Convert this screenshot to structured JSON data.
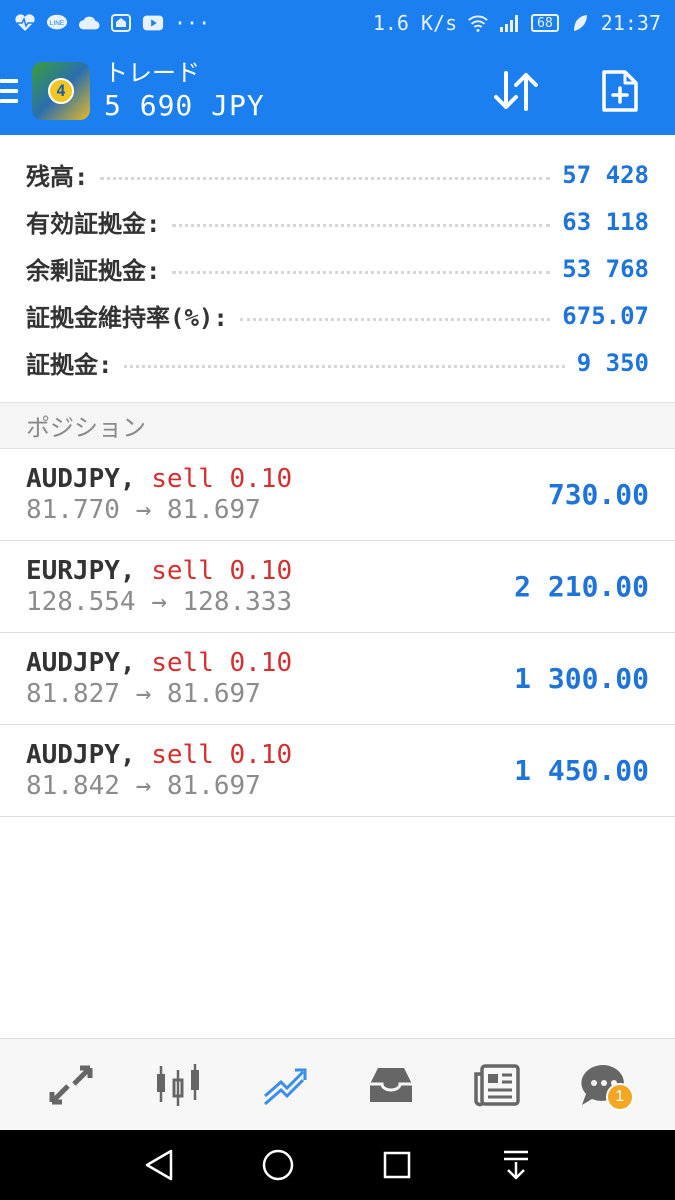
{
  "statusbar": {
    "network_speed": "1.6 K/s",
    "battery": "68",
    "time": "21:37",
    "dots": "···",
    "icons": [
      "heart-pulse-icon",
      "line-app-icon",
      "cloud-icon",
      "home-icon",
      "youtube-icon",
      "wifi-icon",
      "signal-icon",
      "leaf-icon"
    ]
  },
  "appbar": {
    "title": "トレード",
    "subtitle": "5 690 JPY",
    "logo_char": "4",
    "colors": {
      "bar": "#1b7ff0",
      "accent_value": "#1e74d8",
      "sell": "#d43030"
    }
  },
  "summary": [
    {
      "label": "残高:",
      "value": "57 428"
    },
    {
      "label": "有効証拠金:",
      "value": "63 118"
    },
    {
      "label": "余剰証拠金:",
      "value": "53 768"
    },
    {
      "label": "証拠金維持率(%):",
      "value": "675.07"
    },
    {
      "label": "証拠金:",
      "value": "9 350"
    }
  ],
  "positions_header": "ポジション",
  "positions": [
    {
      "symbol": "AUDJPY",
      "sep": ",",
      "type": "sell 0.10",
      "prices": "81.770 → 81.697",
      "profit": "730.00"
    },
    {
      "symbol": "EURJPY",
      "sep": ",",
      "type": "sell 0.10",
      "prices": "128.554 → 128.333",
      "profit": "2 210.00"
    },
    {
      "symbol": "AUDJPY",
      "sep": ",",
      "type": "sell 0.10",
      "prices": "81.827 → 81.697",
      "profit": "1 300.00"
    },
    {
      "symbol": "AUDJPY",
      "sep": ",",
      "type": "sell 0.10",
      "prices": "81.842 → 81.697",
      "profit": "1 450.00"
    }
  ],
  "bottomnav": {
    "items": [
      "quotes-arrows-icon",
      "chart-candles-icon",
      "trade-icon",
      "mailbox-icon",
      "news-icon",
      "chat-icon"
    ],
    "active": "trade-icon",
    "chat_badge": "1"
  }
}
